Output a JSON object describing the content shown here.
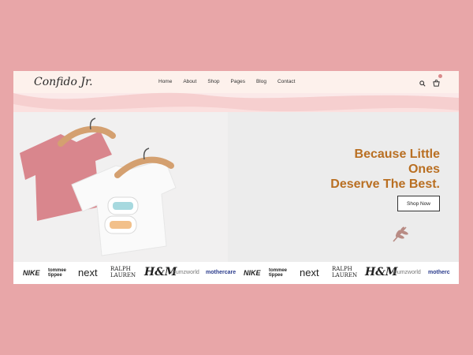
{
  "brand": {
    "logo_text": "Confido Jr."
  },
  "nav": {
    "items": [
      "Home",
      "About",
      "Shop",
      "Pages",
      "Blog",
      "Contact"
    ]
  },
  "header": {
    "search_icon": "search-icon",
    "cart_icon": "cart-icon"
  },
  "hero": {
    "headline_lines": [
      "Because Little",
      "Ones",
      "Deserve The Best."
    ],
    "cta_label": "Shop Now",
    "slider_dots": 3,
    "active_slide": 3
  },
  "brands": {
    "row": [
      "NIKE",
      "tommee tippee",
      "next",
      "RALPH LAUREN",
      "H&M",
      "mumzworld",
      "mothercare",
      "NIKE",
      "tommee tippee",
      "next",
      "RALPH LAUREN",
      "H&M",
      "mumzworld",
      "motherc"
    ]
  },
  "colors": {
    "page_bg": "#e8a6a8",
    "accent": "#b96f22",
    "hero_bg": "#fbe9e9",
    "nav_bg": "#fdf1ec"
  }
}
